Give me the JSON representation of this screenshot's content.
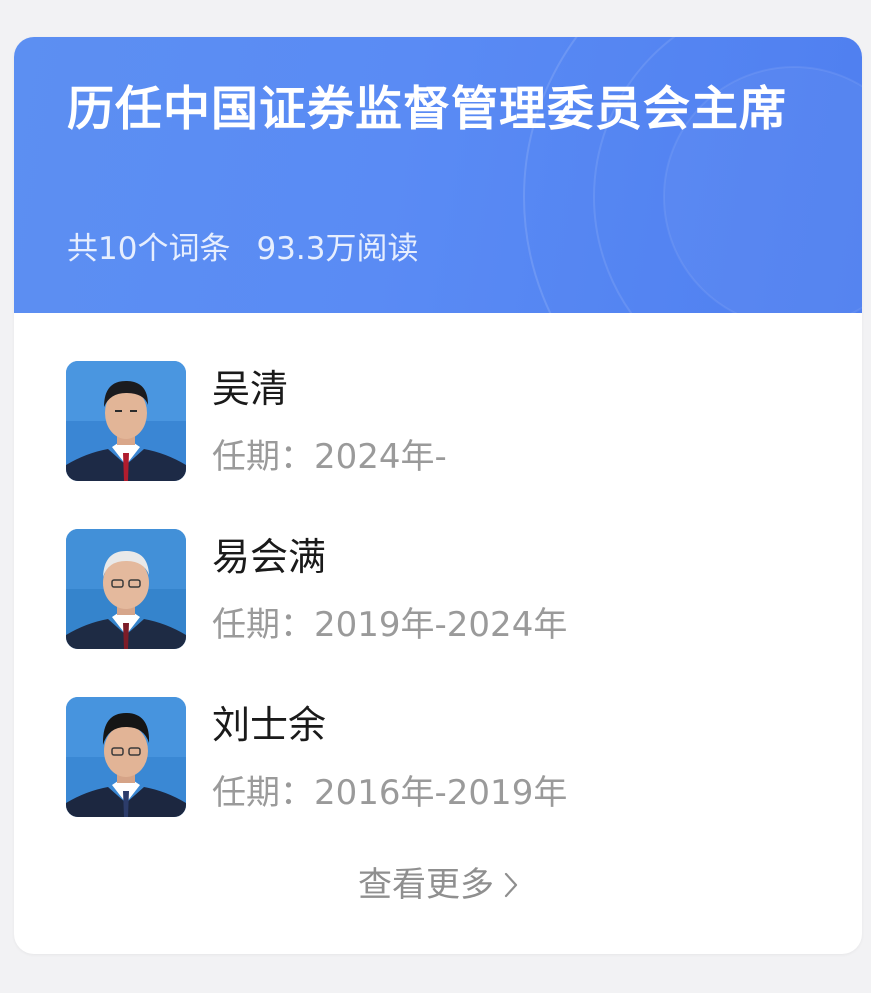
{
  "header": {
    "title": "历任中国证券监督管理委员会主席",
    "entry_count": "共10个词条",
    "views": "93.3万阅读"
  },
  "people": [
    {
      "name": "吴清",
      "term": "任期：2024年-"
    },
    {
      "name": "易会满",
      "term": "任期：2019年-2024年"
    },
    {
      "name": "刘士余",
      "term": "任期：2016年-2019年"
    }
  ],
  "more": {
    "label": "查看更多",
    "icon": "chevron-right-icon"
  },
  "colors": {
    "header_blue": "#5a8bf4",
    "avatar_bg": "#3d8bd6",
    "muted_text": "#9a9a9a"
  }
}
